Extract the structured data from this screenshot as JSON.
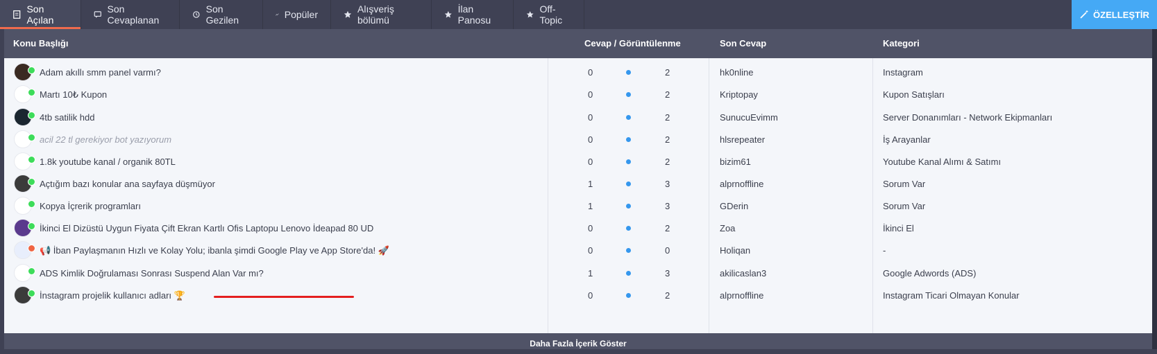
{
  "tabs": [
    {
      "label": "Son Açılan",
      "icon": "document-icon",
      "active": true
    },
    {
      "label": "Son Cevaplanan",
      "icon": "comment-icon",
      "active": false
    },
    {
      "label": "Son Gezilen",
      "icon": "history-icon",
      "active": false
    },
    {
      "label": "Popüler",
      "icon": "trend-icon",
      "active": false
    },
    {
      "label": "Alışveriş bölümü",
      "icon": "star-icon",
      "active": false
    },
    {
      "label": "İlan Panosu",
      "icon": "star-icon",
      "active": false
    },
    {
      "label": "Off-Topic",
      "icon": "star-icon",
      "active": false
    }
  ],
  "customize_label": "ÖZELLEŞTİR",
  "columns": {
    "title": "Konu Başlığı",
    "stats": "Cevap / Görüntülenme",
    "last": "Son Cevap",
    "category": "Kategori"
  },
  "threads": [
    {
      "title": "Adam akıllı smm panel varmı?",
      "replies": "0",
      "views": "2",
      "last": "hk0nline",
      "category": "Instagram"
    },
    {
      "title": "Martı 10₺ Kupon",
      "replies": "0",
      "views": "2",
      "last": "Kriptopay",
      "category": "Kupon Satışları"
    },
    {
      "title": "4tb satilik hdd",
      "replies": "0",
      "views": "2",
      "last": "SunucuEvimm",
      "category": "Server Donanımları - Network Ekipmanları"
    },
    {
      "title": "acil 22 tl gerekiyor bot yazıyorum",
      "replies": "0",
      "views": "2",
      "last": "hlsrepeater",
      "category": "İş Arayanlar"
    },
    {
      "title": "1.8k youtube kanal / organik 80TL",
      "replies": "0",
      "views": "2",
      "last": "bizim61",
      "category": "Youtube Kanal Alımı & Satımı"
    },
    {
      "title": "Açtığım bazı konular ana sayfaya düşmüyor",
      "replies": "1",
      "views": "3",
      "last": "alprnoffline",
      "category": "Sorum Var"
    },
    {
      "title": "Kopya İçrerik programları",
      "replies": "1",
      "views": "3",
      "last": "GDerin",
      "category": "Sorum Var"
    },
    {
      "title": "İkinci El Dizüstü Uygun Fiyata Çift Ekran Kartlı Ofis Laptopu Lenovo İdeapad 80 UD",
      "replies": "0",
      "views": "2",
      "last": "Zoa",
      "category": "İkinci El"
    },
    {
      "title": "📢 İban Paylaşmanın Hızlı ve Kolay Yolu; ibanla şimdi Google Play ve App Store'da! 🚀",
      "replies": "0",
      "views": "0",
      "last": "Holiqan",
      "category": "-"
    },
    {
      "title": "ADS Kimlik Doğrulaması Sonrası Suspend Alan Var mı?",
      "replies": "1",
      "views": "3",
      "last": "akilicaslan3",
      "category": "Google Adwords (ADS)"
    },
    {
      "title": "İnstagram projelik kullanıcı adları 🏆",
      "replies": "0",
      "views": "2",
      "last": "alprnoffline",
      "category": "Instagram Ticari Olmayan Konular"
    }
  ],
  "more_label": "Daha Fazla İçerik Göster"
}
